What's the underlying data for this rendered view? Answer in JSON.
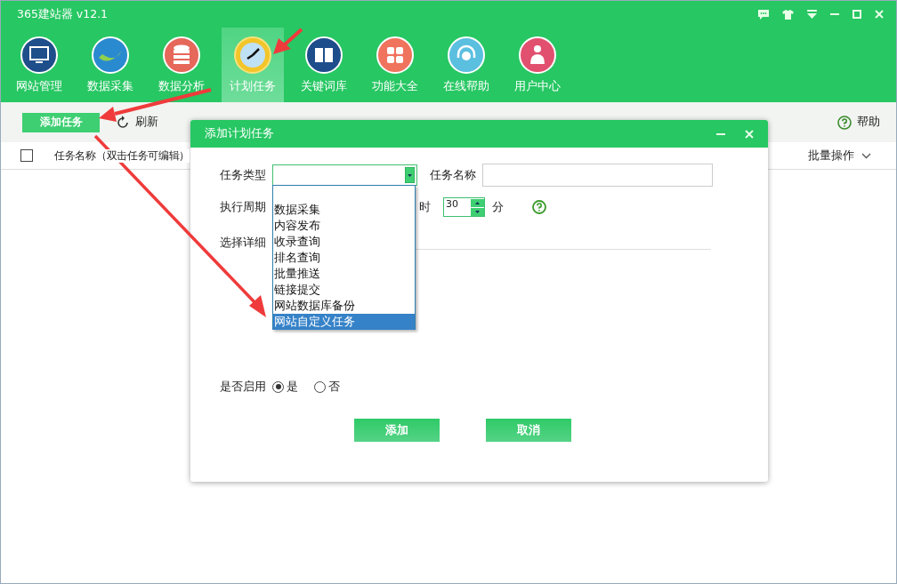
{
  "window": {
    "title": "365建站器 v12.1"
  },
  "nav": [
    {
      "label": "网站管理",
      "selected": false
    },
    {
      "label": "数据采集",
      "selected": false
    },
    {
      "label": "数据分析",
      "selected": false
    },
    {
      "label": "计划任务",
      "selected": true
    },
    {
      "label": "关键词库",
      "selected": false
    },
    {
      "label": "功能大全",
      "selected": false
    },
    {
      "label": "在线帮助",
      "selected": false
    },
    {
      "label": "用户中心",
      "selected": false
    }
  ],
  "toolbar": {
    "add_button": "添加任务",
    "refresh": "刷新",
    "help": "帮助"
  },
  "table": {
    "checked": false,
    "columns": [
      "任务名称（双击任务可编辑）"
    ],
    "batch": "批量操作"
  },
  "dialog": {
    "title": "添加计划任务",
    "task_type_label": "任务类型",
    "task_name_label": "任务名称",
    "period_label": "执行周期",
    "hour_unit": "时",
    "minutes": "30",
    "minute_unit": "分",
    "detail_label": "选择详细",
    "enable_label": "是否启用",
    "enable_options": [
      {
        "label": "是",
        "selected": true
      },
      {
        "label": "否",
        "selected": false
      }
    ],
    "buttons": [
      "添加",
      "取消"
    ],
    "dropdown_options": [
      {
        "label": "数据采集",
        "selected": false
      },
      {
        "label": "内容发布",
        "selected": false
      },
      {
        "label": "收录查询",
        "selected": false
      },
      {
        "label": "排名查询",
        "selected": false
      },
      {
        "label": "批量推送",
        "selected": false
      },
      {
        "label": "链接提交",
        "selected": false
      },
      {
        "label": "网站数据库备份",
        "selected": false
      },
      {
        "label": "网站自定义任务",
        "selected": true
      }
    ]
  }
}
